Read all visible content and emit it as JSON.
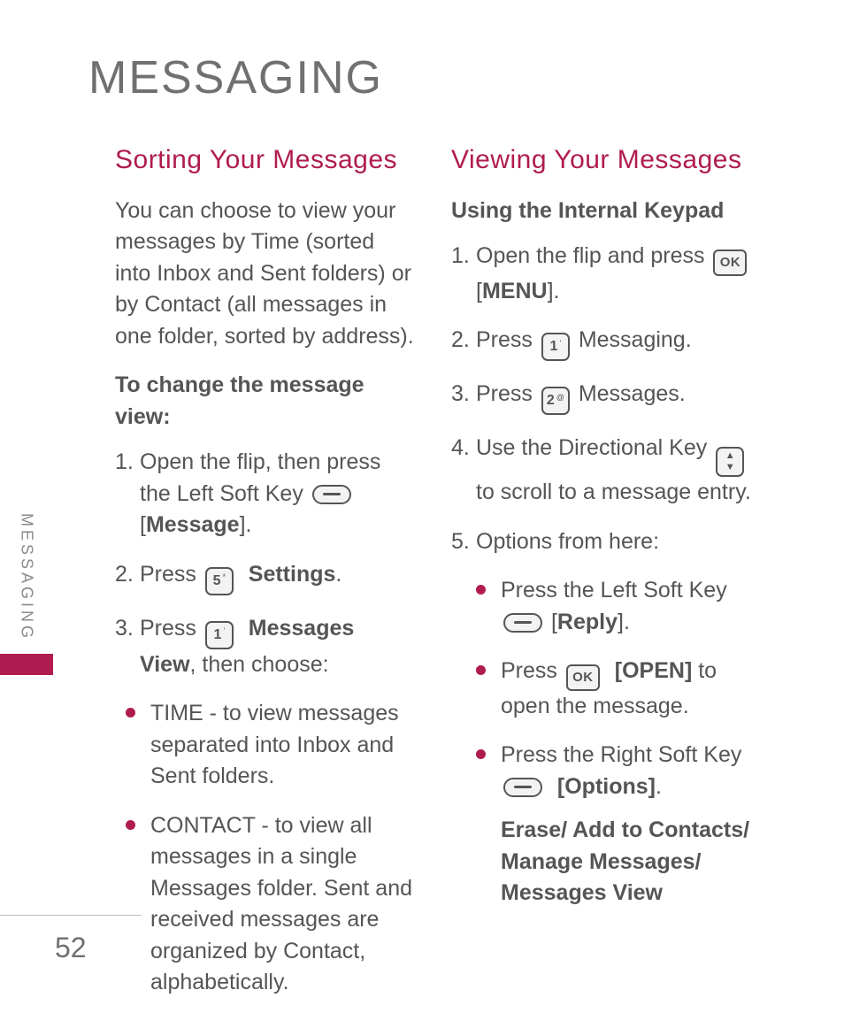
{
  "page": {
    "title": "MESSAGING",
    "side_label": "MESSAGING",
    "number": "52"
  },
  "left": {
    "heading": "Sorting Your Messages",
    "intro": "You can choose to view your messages by Time (sorted into Inbox and Sent folders) or by Contact (all messages in one folder, sorted by address).",
    "subheading": "To change the message view:",
    "step1a": "Open the flip, then press the Left Soft Key ",
    "step1b": " [",
    "step1c": "Message",
    "step1d": "].",
    "step2a": "Press ",
    "step2b_bold": "Settings",
    "step2c": ".",
    "step3a": "Press ",
    "step3b_bold": "Messages View",
    "step3c": ", then choose:",
    "bullet1": "TIME - to view messages separated into Inbox and Sent folders.",
    "bullet2": "CONTACT - to view all messages in a single Messages folder. Sent and received messages are organized by Contact, alphabetically."
  },
  "right": {
    "heading": "Viewing Your Messages",
    "subheading": "Using the Internal Keypad",
    "step1a": "Open the flip and press ",
    "step1b": " [",
    "step1c": "MENU",
    "step1d": "].",
    "step2a": "Press ",
    "step2b": " Messaging.",
    "step3a": "Press ",
    "step3b": " Messages.",
    "step4a": "Use the Directional Key ",
    "step4b": " to scroll to a message entry.",
    "step5": "Options from here:",
    "opt1a": "Press the Left Soft Key ",
    "opt1b": " [",
    "opt1c": "Reply",
    "opt1d": "].",
    "opt2a": "Press ",
    "opt2b_bold": "[OPEN]",
    "opt2c": " to open the message.",
    "opt3a": "Press the Right Soft Key ",
    "opt3b_bold": "[Options]",
    "opt3c": ".",
    "opt_extra": "Erase/ Add to Contacts/ Manage Messages/ Messages View"
  },
  "keys": {
    "ok": "OK",
    "k1": "1",
    "k1s": "'",
    "k2": "2",
    "k2s": "@",
    "k5": "5",
    "k5s": "*"
  }
}
